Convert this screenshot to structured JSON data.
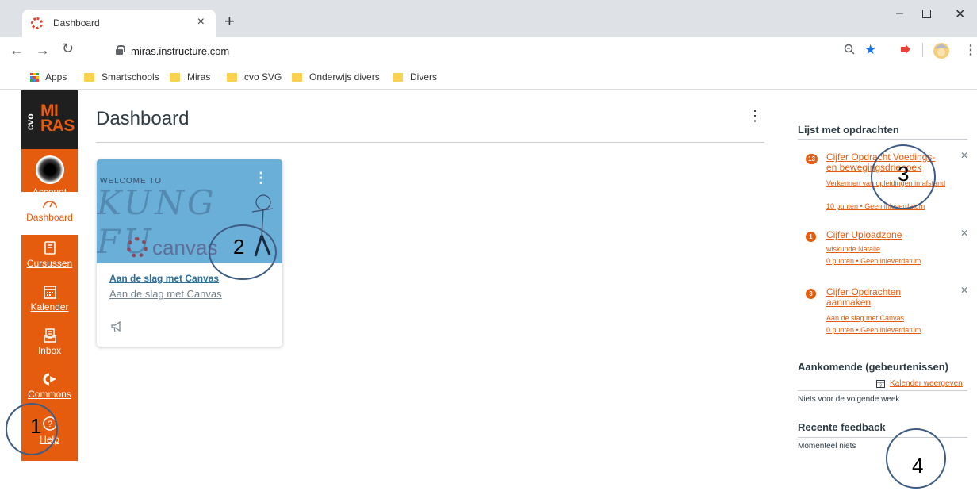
{
  "browser": {
    "tab_title": "Dashboard",
    "tab_close": "×",
    "new_tab": "+",
    "url": "miras.instructure.com",
    "bookmarks": [
      {
        "label": "Apps",
        "type": "apps"
      },
      {
        "label": "Smartschools",
        "type": "folder"
      },
      {
        "label": "Miras",
        "type": "folder"
      },
      {
        "label": "cvo SVG",
        "type": "folder"
      },
      {
        "label": "Onderwijs divers",
        "type": "folder"
      },
      {
        "label": "Divers",
        "type": "folder"
      }
    ],
    "icons": {
      "back": "back-arrow-icon",
      "forward": "forward-arrow-icon",
      "reload": "reload-icon",
      "zoom": "zoom-icon",
      "star": "bookmark-star-icon",
      "extension": "extension-icon",
      "profile": "profile-icon",
      "menu": "menu-icon"
    },
    "colors": {
      "star": "#1a73e8",
      "extension": "#e94235"
    }
  },
  "logo": {
    "cvo": "cvo",
    "miras_line1": "MI",
    "miras_line2": "RAS"
  },
  "globalnav": {
    "items": [
      {
        "label": "Account",
        "icon": "avatar"
      },
      {
        "label": "Dashboard",
        "icon": "speedometer-icon",
        "active": true
      },
      {
        "label": "Cursussen",
        "icon": "book-icon"
      },
      {
        "label": "Kalender",
        "icon": "calendar-icon"
      },
      {
        "label": "Inbox",
        "icon": "inbox-icon"
      },
      {
        "label": "Commons",
        "icon": "commons-icon"
      },
      {
        "label": "Help",
        "icon": "help-icon"
      }
    ],
    "color": "#e65c0e"
  },
  "main": {
    "title": "Dashboard",
    "card": {
      "hero_welcome": "WELCOME TO",
      "hero_kung": "KUNG FU",
      "hero_canvas": "canvas",
      "link": "Aan de slag met Canvas",
      "subtitle": "Aan de slag met Canvas"
    }
  },
  "sidebar": {
    "todo_heading": "Lijst met opdrachten",
    "todos": [
      {
        "badge": "13",
        "title": "Cijfer Opdracht Voedings- en bewegingsdriehoek",
        "course": "Verkennen van opleidingen in afstand",
        "meta": "10 punten • Geen inleverdatum"
      },
      {
        "badge": "1",
        "title": "Cijfer Uploadzone",
        "course": "wiskunde Natalie",
        "meta": "0 punten • Geen inleverdatum"
      },
      {
        "badge": "3",
        "title": "Cijfer Opdrachten aanmaken",
        "course": "Aan de slag met Canvas",
        "meta": "0 punten • Geen inleverdatum"
      }
    ],
    "upcoming_heading": "Aankomende (gebeurtenissen)",
    "calendar_link": "Kalender weergeven",
    "upcoming_empty": "Niets voor de volgende week",
    "feedback_heading": "Recente feedback",
    "feedback_empty": "Momenteel niets"
  },
  "annotations": [
    "1",
    "2",
    "3",
    "4"
  ]
}
